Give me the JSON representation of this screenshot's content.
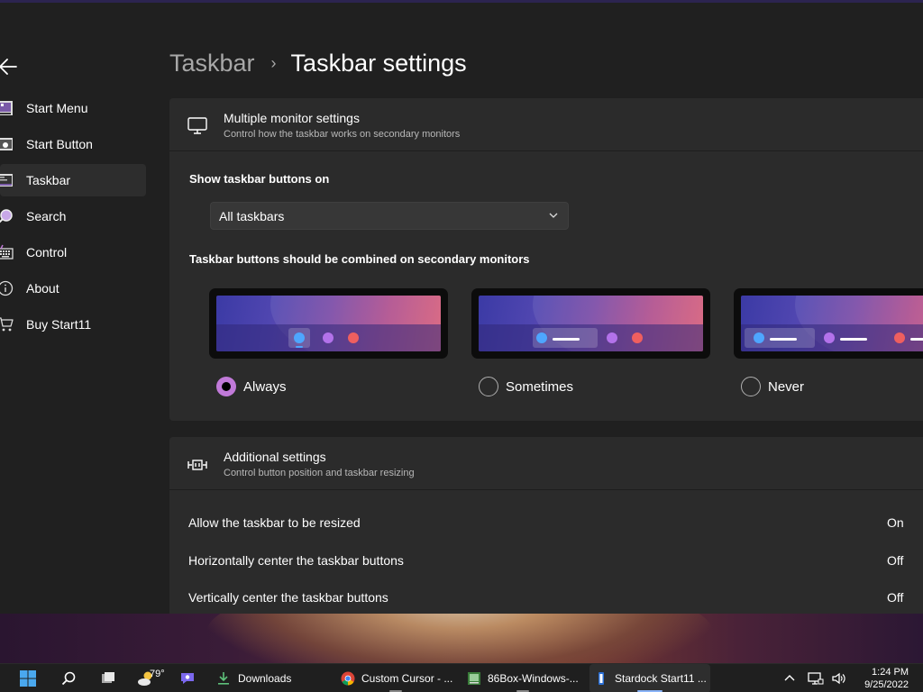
{
  "breadcrumb": {
    "parent": "Taskbar",
    "separator": "›",
    "current": "Taskbar settings"
  },
  "sidebar": {
    "items": [
      {
        "label": "Start Menu",
        "icon": "start-menu-icon"
      },
      {
        "label": "Start Button",
        "icon": "start-button-icon"
      },
      {
        "label": "Taskbar",
        "icon": "taskbar-icon",
        "active": true
      },
      {
        "label": "Search",
        "icon": "search-icon"
      },
      {
        "label": "Control",
        "icon": "keyboard-icon"
      },
      {
        "label": "About",
        "icon": "info-icon"
      },
      {
        "label": "Buy Start11",
        "icon": "cart-icon"
      }
    ]
  },
  "monitor_card": {
    "title": "Multiple monitor settings",
    "subtitle": "Control how the taskbar works on secondary monitors",
    "show_buttons_label": "Show taskbar buttons on",
    "dropdown_value": "All taskbars",
    "combine_label": "Taskbar buttons should be combined on secondary monitors",
    "options": [
      {
        "label": "Always",
        "checked": true
      },
      {
        "label": "Sometimes",
        "checked": false
      },
      {
        "label": "Never",
        "checked": false
      }
    ]
  },
  "additional_card": {
    "title": "Additional settings",
    "subtitle": "Control button position and taskbar resizing",
    "rows": [
      {
        "label": "Allow the taskbar to be resized",
        "value": "On"
      },
      {
        "label": "Horizontally center the taskbar buttons",
        "value": "Off"
      },
      {
        "label": "Vertically center the taskbar buttons",
        "value": "Off"
      }
    ]
  },
  "taskbar": {
    "weather_temp": "79°",
    "apps": [
      {
        "label": "Downloads",
        "icon": "download-folder-icon"
      },
      {
        "label": "Custom Cursor - ...",
        "icon": "chrome-icon"
      },
      {
        "label": "86Box-Windows-...",
        "icon": "86box-icon"
      },
      {
        "label": "Stardock Start11 ...",
        "icon": "start11-icon",
        "active": true
      }
    ],
    "time": "1:24 PM",
    "date": "9/25/2022"
  },
  "colors": {
    "accent": "#c17ad9",
    "window_bg": "#202020",
    "card_bg": "#2b2b2b",
    "taskbar_bg": "#1f1f1f"
  }
}
